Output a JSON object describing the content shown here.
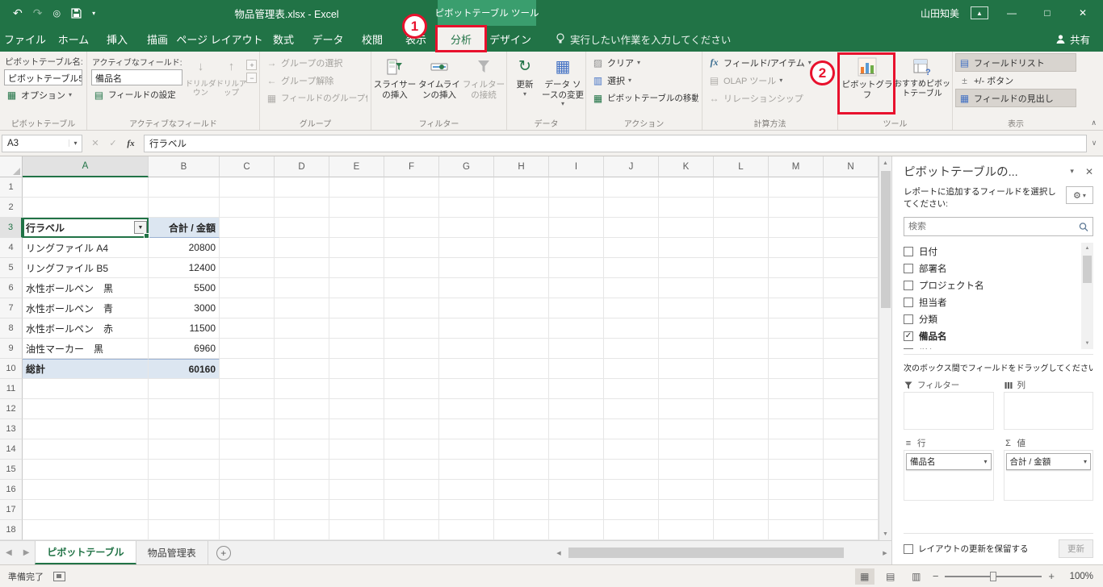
{
  "colors": {
    "excel_green": "#217346",
    "contextual_green": "#3a9e6e",
    "annotation_red": "#e8112d",
    "pivot_fill": "#dce6f1"
  },
  "title_bar": {
    "document_title": "物品管理表.xlsx  -  Excel",
    "contextual_header": "ピボットテーブル ツール",
    "user_name": "山田知美"
  },
  "tabs": {
    "file": "ファイル",
    "items": [
      {
        "label": "ホーム"
      },
      {
        "label": "挿入"
      },
      {
        "label": "描画"
      },
      {
        "label": "ページ レイアウト"
      },
      {
        "label": "数式"
      },
      {
        "label": "データ"
      },
      {
        "label": "校閲"
      },
      {
        "label": "表示"
      },
      {
        "label": "分析",
        "active": true
      },
      {
        "label": "デザイン"
      }
    ],
    "tell_me": "実行したい作業を入力してください",
    "share": "共有"
  },
  "ribbon": {
    "pivot_group": {
      "title": "ピボットテーブル",
      "name_label": "ピボットテーブル名:",
      "name_value": "ピボットテーブル5",
      "options": "オプション"
    },
    "active_field_group": {
      "title": "アクティブなフィールド",
      "label": "アクティブなフィールド:",
      "value": "備品名",
      "field_settings": "フィールドの設定",
      "drill_down": "ドリルダウン",
      "drill_up": "ドリルアップ"
    },
    "group_group": {
      "title": "グループ",
      "items": [
        "グループの選択",
        "グループ解除",
        "フィールドのグループ化"
      ]
    },
    "filter_group": {
      "title": "フィルター",
      "items": [
        "スライサーの挿入",
        "タイムラインの挿入",
        "フィルターの接続"
      ]
    },
    "data_group": {
      "title": "データ",
      "items": [
        "更新",
        "データ ソースの変更"
      ]
    },
    "action_group": {
      "title": "アクション",
      "items": [
        "クリア",
        "選択",
        "ピボットテーブルの移動"
      ]
    },
    "calc_group": {
      "title": "計算方法",
      "items": [
        "フィールド/アイテム",
        "OLAP ツール",
        "リレーションシップ"
      ]
    },
    "tools_group": {
      "title": "ツール",
      "pivot_chart": "ピボットグラフ",
      "recommended": "おすすめピボットテーブル"
    },
    "show_group": {
      "title": "表示",
      "items": [
        "フィールドリスト",
        "+/- ボタン",
        "フィールドの見出し"
      ]
    }
  },
  "formula_bar": {
    "name_box": "A3",
    "fx": "fx",
    "content": "行ラベル"
  },
  "grid": {
    "columns": [
      "A",
      "B",
      "C",
      "D",
      "E",
      "F",
      "G",
      "H",
      "I",
      "J",
      "K",
      "L",
      "M",
      "N"
    ],
    "row_count": 18,
    "selected_cell": "A3",
    "pivot": {
      "row_label_header": "行ラベル",
      "value_header": "合計 / 金額",
      "rows": [
        {
          "label": "リングファイル A4",
          "value": "20800"
        },
        {
          "label": "リングファイル B5",
          "value": "12400"
        },
        {
          "label": "水性ボールペン　黒",
          "value": "5500"
        },
        {
          "label": "水性ボールペン　青",
          "value": "3000"
        },
        {
          "label": "水性ボールペン　赤",
          "value": "11500"
        },
        {
          "label": "油性マーカー　黒",
          "value": "6960"
        }
      ],
      "total_label": "総計",
      "total_value": "60160"
    }
  },
  "field_pane": {
    "title": "ピボットテーブルの...",
    "subtitle": "レポートに追加するフィールドを選択してください:",
    "search_placeholder": "検索",
    "fields": [
      {
        "label": "日付",
        "checked": false
      },
      {
        "label": "部署名",
        "checked": false
      },
      {
        "label": "プロジェクト名",
        "checked": false
      },
      {
        "label": "担当者",
        "checked": false
      },
      {
        "label": "分類",
        "checked": false
      },
      {
        "label": "備品名",
        "checked": true
      },
      {
        "label": "単価",
        "checked": false
      }
    ],
    "drag_hint": "次のボックス間でフィールドをドラッグしてください:",
    "areas": [
      {
        "label": "フィルター",
        "items": []
      },
      {
        "label": "列",
        "items": []
      },
      {
        "label": "行",
        "items": [
          "備品名"
        ]
      },
      {
        "label": "値",
        "items": [
          "合計 / 金額"
        ]
      }
    ],
    "defer_label": "レイアウトの更新を保留する",
    "update_label": "更新"
  },
  "sheet_bar": {
    "tabs": [
      {
        "label": "ピボットテーブル",
        "active": true
      },
      {
        "label": "物品管理表",
        "active": false
      }
    ]
  },
  "status_bar": {
    "ready": "準備完了",
    "zoom": "100%"
  },
  "annotations": {
    "step1": "1",
    "step2": "2"
  }
}
